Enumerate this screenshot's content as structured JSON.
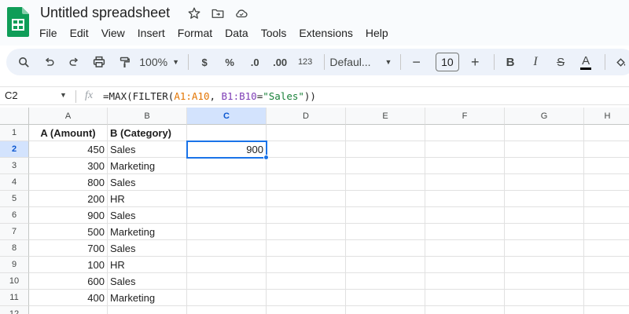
{
  "app": {
    "doc_title": "Untitled spreadsheet",
    "menu": [
      "File",
      "Edit",
      "View",
      "Insert",
      "Format",
      "Data",
      "Tools",
      "Extensions",
      "Help"
    ],
    "brand_color": "#0f9d58"
  },
  "toolbar": {
    "zoom": "100%",
    "currency": "$",
    "percent": "%",
    "decrease_decimal": ".0",
    "increase_decimal": ".00",
    "number_format": "123",
    "font": "Defaul...",
    "font_size": "10",
    "bold": "B",
    "italic": "I",
    "strikethrough": "S",
    "text_color": "A"
  },
  "formula_bar": {
    "name_box": "C2",
    "fx": "fx",
    "formula_parts": {
      "p1": "=MAX(FILTER(",
      "r1": "A1:A10",
      "p2": ", ",
      "r2": "B1:B10",
      "p3": "=",
      "s1": "\"Sales\"",
      "p4": "))"
    }
  },
  "sheet": {
    "columns": [
      "A",
      "B",
      "C",
      "D",
      "E",
      "F",
      "G",
      "H"
    ],
    "selected_cell": "C2",
    "rows": [
      {
        "n": "1",
        "a": "A (Amount)",
        "b": "B (Category)",
        "c": ""
      },
      {
        "n": "2",
        "a": "450",
        "b": "Sales",
        "c": "900"
      },
      {
        "n": "3",
        "a": "300",
        "b": "Marketing",
        "c": ""
      },
      {
        "n": "4",
        "a": "800",
        "b": "Sales",
        "c": ""
      },
      {
        "n": "5",
        "a": "200",
        "b": "HR",
        "c": ""
      },
      {
        "n": "6",
        "a": "900",
        "b": "Sales",
        "c": ""
      },
      {
        "n": "7",
        "a": "500",
        "b": "Marketing",
        "c": ""
      },
      {
        "n": "8",
        "a": "700",
        "b": "Sales",
        "c": ""
      },
      {
        "n": "9",
        "a": "100",
        "b": "HR",
        "c": ""
      },
      {
        "n": "10",
        "a": "600",
        "b": "Sales",
        "c": ""
      },
      {
        "n": "11",
        "a": "400",
        "b": "Marketing",
        "c": ""
      },
      {
        "n": "12",
        "a": "",
        "b": "",
        "c": ""
      }
    ]
  }
}
